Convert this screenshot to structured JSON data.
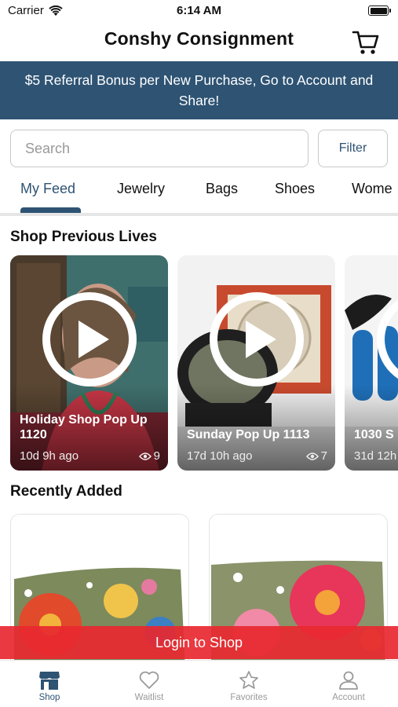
{
  "status_bar": {
    "carrier": "Carrier",
    "time": "6:14 AM"
  },
  "header": {
    "title": "Conshy Consignment",
    "cart_icon": "cart-icon"
  },
  "banner": {
    "text": "$5 Referral Bonus per New Purchase, Go to Account and Share!"
  },
  "search": {
    "placeholder": "Search",
    "value": ""
  },
  "filter": {
    "label": "Filter"
  },
  "category_tabs": [
    {
      "label": "My Feed",
      "active": true
    },
    {
      "label": "Jewelry",
      "active": false
    },
    {
      "label": "Bags",
      "active": false
    },
    {
      "label": "Shoes",
      "active": false
    },
    {
      "label": "Wome",
      "active": false
    }
  ],
  "previous_lives": {
    "title": "Shop Previous Lives",
    "items": [
      {
        "title": "Holiday Shop Pop Up 1120",
        "ago": "10d 9h ago",
        "views": "9"
      },
      {
        "title": "Sunday Pop Up 1113",
        "ago": "17d 10h ago",
        "views": "7"
      },
      {
        "title": "1030 S",
        "ago": "31d 12h",
        "views": ""
      }
    ]
  },
  "recently_added": {
    "title": "Recently Added"
  },
  "login_bar": {
    "label": "Login to Shop"
  },
  "tab_bar": [
    {
      "label": "Shop",
      "icon": "shop-icon",
      "active": true
    },
    {
      "label": "Waitlist",
      "icon": "heart-icon",
      "active": false
    },
    {
      "label": "Favorites",
      "icon": "star-icon",
      "active": false
    },
    {
      "label": "Account",
      "icon": "person-icon",
      "active": false
    }
  ],
  "colors": {
    "brand": "#2e5373",
    "login_bar": "#e82830",
    "muted": "#999999"
  }
}
